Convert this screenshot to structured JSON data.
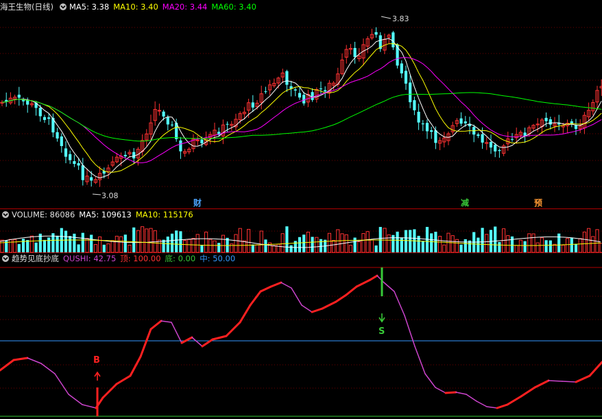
{
  "price_pane": {
    "stock_name": "海王生物(日线)",
    "ma5_label": "MA5: 3.38",
    "ma10_label": "MA10: 3.40",
    "ma20_label": "MA20: 3.44",
    "ma60_label": "MA60: 3.40",
    "high_label": "3.83",
    "low_label": "3.08",
    "markers": [
      {
        "text": "财",
        "color": "#4aa3ff"
      },
      {
        "text": "减",
        "color": "#37c837"
      },
      {
        "text": "预",
        "color": "#ff9933"
      }
    ]
  },
  "volume_pane": {
    "volume_label": "VOLUME: 86086",
    "ma5_label": "MA5: 109613",
    "ma10_label": "MA10: 115176"
  },
  "indicator_pane": {
    "name": "趋势见底抄底",
    "qushi_label": "QUSHI: 42.75",
    "top_label": "顶: 100.00",
    "bottom_label": "底: 0.00",
    "mid_label": "中: 50.00",
    "buy_signal": "B",
    "sell_signal": "S"
  },
  "colors": {
    "up": "#ff3232",
    "down": "#54ffff",
    "ma5": "#ffffff",
    "ma10": "#ffff00",
    "ma20": "#ff00ff",
    "ma60": "#00ff00",
    "qushi_up": "#ff2020",
    "qushi_down": "#cc44cc",
    "midline": "#3399ff"
  },
  "icons": {
    "pane_menu": "chevron-down-icon"
  }
}
